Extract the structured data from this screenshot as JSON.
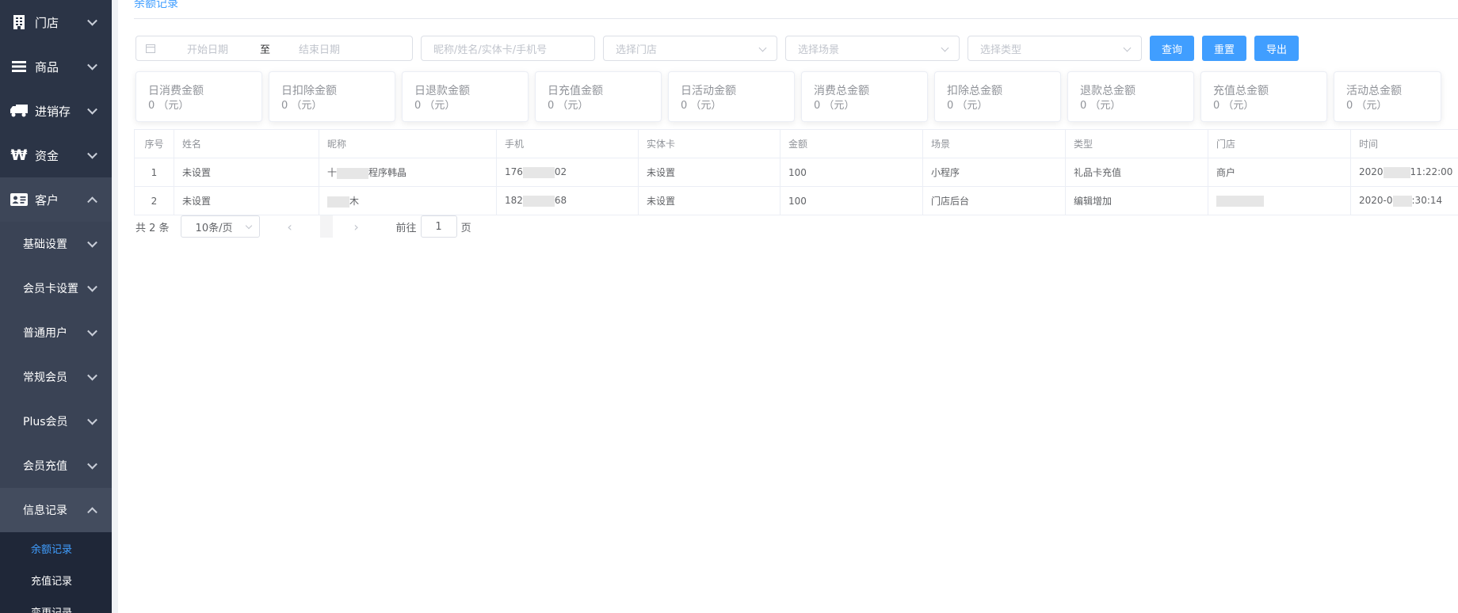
{
  "sidebar": {
    "top_items": [
      {
        "label": "门店",
        "icon": "building-icon"
      },
      {
        "label": "商品",
        "icon": "list-icon"
      },
      {
        "label": "进销存",
        "icon": "truck-icon"
      },
      {
        "label": "资金",
        "icon": "won-icon"
      },
      {
        "label": "客户",
        "icon": "id-card-icon"
      }
    ],
    "customer_sub": [
      {
        "label": "基础设置"
      },
      {
        "label": "会员卡设置"
      },
      {
        "label": "普通用户"
      },
      {
        "label": "常规会员"
      },
      {
        "label": "Plus会员"
      },
      {
        "label": "会员充值"
      },
      {
        "label": "信息记录"
      }
    ],
    "info_leaves": [
      {
        "label": "余额记录"
      },
      {
        "label": "充值记录"
      },
      {
        "label": "变更记录"
      }
    ]
  },
  "page": {
    "title": "余额记录"
  },
  "filters": {
    "start_placeholder": "开始日期",
    "range_sep": "至",
    "end_placeholder": "结束日期",
    "keyword_placeholder": "昵称/姓名/实体卡/手机号",
    "store_placeholder": "选择门店",
    "scene_placeholder": "选择场景",
    "type_placeholder": "选择类型",
    "query_label": "查询",
    "reset_label": "重置",
    "export_label": "导出"
  },
  "stats": [
    {
      "label": "日消费金额",
      "value": "0 （元）"
    },
    {
      "label": "日扣除金额",
      "value": "0 （元）"
    },
    {
      "label": "日退款金额",
      "value": "0 （元）"
    },
    {
      "label": "日充值金额",
      "value": "0 （元）"
    },
    {
      "label": "日活动金额",
      "value": "0 （元）"
    },
    {
      "label": "消费总金额",
      "value": "0 （元）"
    },
    {
      "label": "扣除总金额",
      "value": "0 （元）"
    },
    {
      "label": "退款总金额",
      "value": "0 （元）"
    },
    {
      "label": "充值总金额",
      "value": "0 （元）"
    },
    {
      "label": "活动总金额",
      "value": "0 （元）"
    }
  ],
  "table": {
    "headers": {
      "index": "序号",
      "name": "姓名",
      "nickname": "昵称",
      "phone": "手机",
      "card": "实体卡",
      "amount": "金额",
      "scene": "场景",
      "type": "类型",
      "store": "门店",
      "time": "时间"
    },
    "rows": [
      {
        "index": "1",
        "name": "未设置",
        "nick_a": "十",
        "nick_b": "程序韩晶",
        "phone_a": "176",
        "phone_b": "02",
        "card": "未设置",
        "amount": "100",
        "scene": "小程序",
        "type": "礼品卡充值",
        "store": "商户",
        "time_a": "2020",
        "time_b": "11:22:00"
      },
      {
        "index": "2",
        "name": "未设置",
        "nick_a": "",
        "nick_b": "木",
        "phone_a": "182",
        "phone_b": "68",
        "card": "未设置",
        "amount": "100",
        "scene": "门店后台",
        "type": "编辑增加",
        "store": "",
        "time_a": "2020-0",
        "time_b": ":30:14"
      }
    ]
  },
  "pager": {
    "total": "共 2 条",
    "page_size": "10条/页",
    "prev": "‹",
    "next": "›",
    "goto": "前往",
    "page": "1",
    "page_unit": "页"
  }
}
